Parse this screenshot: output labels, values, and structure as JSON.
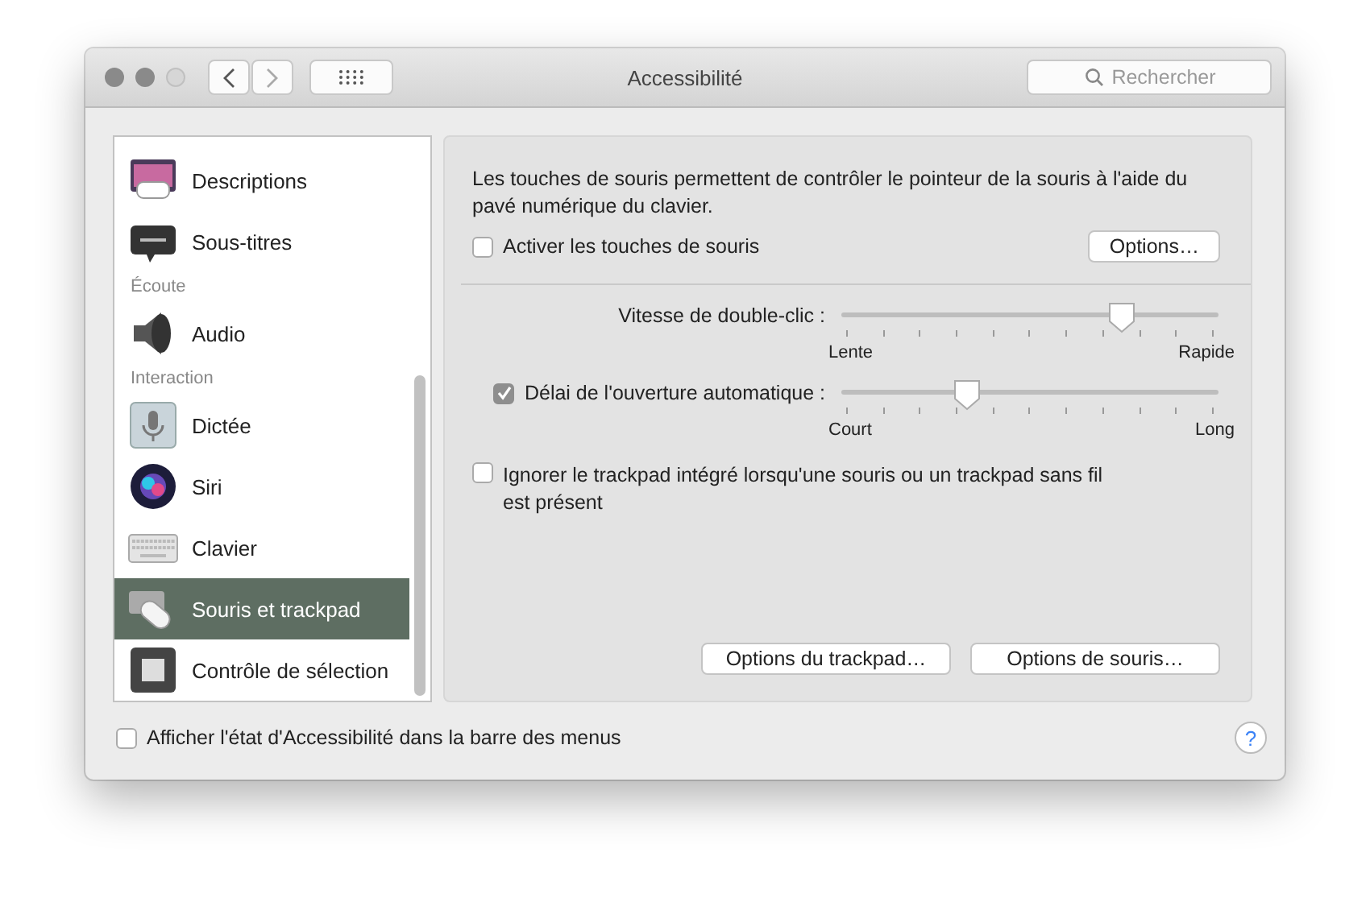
{
  "window": {
    "title": "Accessibilité"
  },
  "search": {
    "placeholder": "Rechercher"
  },
  "sidebar": {
    "items": [
      {
        "kind": "item",
        "label": "Descriptions",
        "selected": false
      },
      {
        "kind": "item",
        "label": "Sous-titres",
        "selected": false
      },
      {
        "kind": "header",
        "label": "Écoute"
      },
      {
        "kind": "item",
        "label": "Audio",
        "selected": false
      },
      {
        "kind": "header",
        "label": "Interaction"
      },
      {
        "kind": "item",
        "label": "Dictée",
        "selected": false
      },
      {
        "kind": "item",
        "label": "Siri",
        "selected": false
      },
      {
        "kind": "item",
        "label": "Clavier",
        "selected": false
      },
      {
        "kind": "item",
        "label": "Souris et trackpad",
        "selected": true
      },
      {
        "kind": "item",
        "label": "Contrôle de sélection",
        "selected": false
      }
    ]
  },
  "panel": {
    "description": "Les touches de souris permettent de contrôler le pointeur de la souris à l'aide du pavé numérique du clavier.",
    "mouse_keys": {
      "label": "Activer les touches de souris",
      "checked": false
    },
    "options_button": "Options…",
    "sliders": [
      {
        "label": "Vitesse de double-clic :",
        "level": 0.69,
        "min_label": "Lente",
        "max_label": "Rapide"
      },
      {
        "label": "Délai de l'ouverture automatique :",
        "checked": true,
        "level": 0.31,
        "min_label": "Court",
        "max_label": "Long"
      }
    ],
    "ignore_trackpad": {
      "label": "Ignorer le trackpad intégré lorsqu'une souris ou un trackpad sans fil est présent",
      "checked": false
    },
    "buttons": [
      "Options du trackpad…",
      "Options de souris…"
    ]
  },
  "footer": {
    "label": "Afficher l'état d'Accessibilité dans la barre des menus",
    "checked": false,
    "help": "?"
  }
}
